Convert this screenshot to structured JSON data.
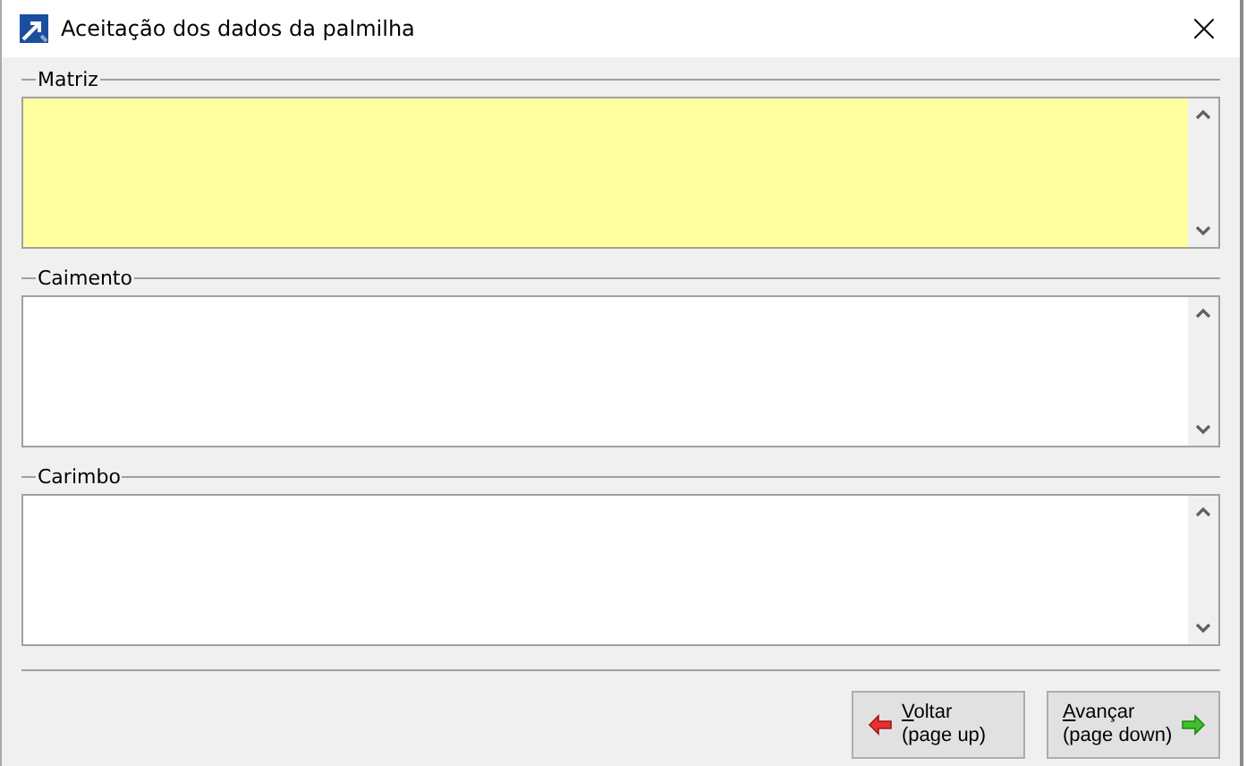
{
  "window": {
    "title": "Aceitação dos dados da palmilha",
    "close": "×"
  },
  "fields": [
    {
      "label": "Matriz",
      "highlighted": true
    },
    {
      "label": "Caimento",
      "highlighted": false
    },
    {
      "label": "Carimbo",
      "highlighted": false
    }
  ],
  "buttons": [
    {
      "kind": "back",
      "hotkey": "V",
      "label_rest": "oltar",
      "hint": "(page up)"
    },
    {
      "kind": "next",
      "hotkey": "A",
      "label_rest": "vançar",
      "hint": "(page down)"
    }
  ]
}
